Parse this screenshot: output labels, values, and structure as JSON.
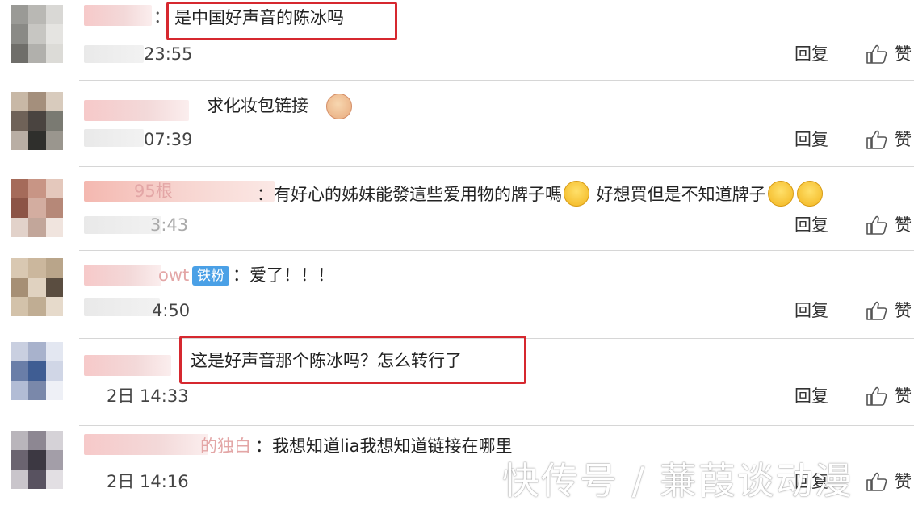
{
  "actions": {
    "reply_label": "回复",
    "like_label": "赞"
  },
  "comments": [
    {
      "name_suffix": "：",
      "text": "是中国好声音的陈冰吗",
      "time": "23:55"
    },
    {
      "name_suffix": "",
      "text": "求化妆包链接",
      "time": "07:39"
    },
    {
      "name_suffix": "95根",
      "text_a": "：有好心的姊妹能發這些爱用物的牌子嗎",
      "text_b": " 好想買但是不知道牌子",
      "time": "3:43"
    },
    {
      "name_suffix": "owt",
      "badge": "铁粉",
      "text": "：爱了！！！",
      "time": "4:50"
    },
    {
      "name_suffix": "",
      "text": "这是好声音那个陈冰吗？怎么转行了",
      "time": "2日 14:33"
    },
    {
      "name_suffix": "的独白",
      "text": "：我想知道lia我想知道链接在哪里",
      "time": "2日 14:16"
    }
  ],
  "watermark": "快传号 / 蒹葭谈动漫"
}
